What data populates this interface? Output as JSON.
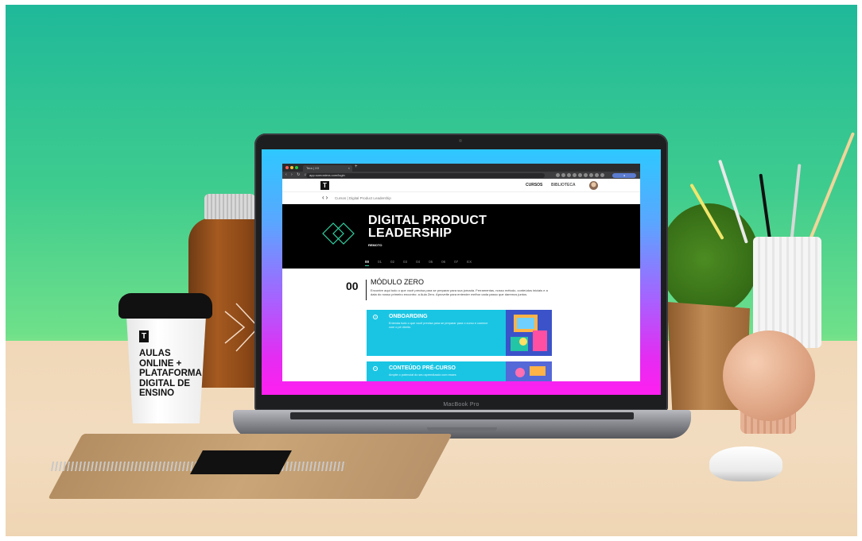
{
  "browser": {
    "tab_title": "Tera | XX",
    "tab_close": "×",
    "new_tab": "+",
    "url": "app.somostera.com/login"
  },
  "app": {
    "logo": "T",
    "nav": {
      "cursos": "CURSOS",
      "biblioteca": "BIBLIOTECA"
    },
    "breadcrumb": "Cursos | Digital Product Leadership"
  },
  "hero": {
    "title_line1": "DIGITAL PRODUCT",
    "title_line2": "LEADERSHIP",
    "subtitle": "REMOTO",
    "tabs": [
      "00",
      "01",
      "02",
      "03",
      "04",
      "05",
      "06",
      "07",
      "EX"
    ],
    "active_tab": "00"
  },
  "module": {
    "number": "00",
    "title": "MÓDULO ZERO",
    "description": "Encontre aqui tudo o que você precisa para se preparar para sua jornada. Ferramentas, nosso método, conteúdos iniciais e a data do nosso primeiro encontro: a Aula Zero. Aproveite para entender melhor cada passo que daremos juntos.",
    "cards": [
      {
        "title": "ONBOARDING",
        "description": "Entenda tudo o que você precisa para se preparar para o curso e comece com o pé direito."
      },
      {
        "title": "CONTEÚDO PRÉ-CURSO",
        "description": "Amplie o potencial do seu aprendizado com esses"
      }
    ]
  },
  "device": {
    "brand": "MacBook Pro"
  },
  "props": {
    "cup_logo": "T",
    "cup_text": "AULAS\nONLINE +\nPLATAFORMA\nDIGITAL DE\nENSINO"
  },
  "colors": {
    "accent": "#2fd3a2",
    "card": "#1ac5e3",
    "hero_bg": "#000000"
  }
}
